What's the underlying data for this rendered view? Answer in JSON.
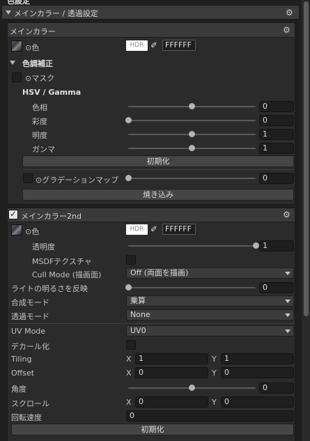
{
  "top_section_title": "色設定",
  "section_header": "メインカラー / 透過設定",
  "main_color_panel": {
    "title": "メインカラー",
    "color_label": "⊙色",
    "hdr_label": "HDR",
    "hex_value": "FFFFFF",
    "color_correction_label": "色調補正",
    "mask_label": "⊙マスク",
    "hsv_heading": "HSV / Gamma",
    "hue_label": "色相",
    "hue_value": "0",
    "saturation_label": "彩度",
    "saturation_value": "0",
    "brightness_label": "明度",
    "brightness_value": "1",
    "gamma_label": "ガンマ",
    "gamma_value": "1",
    "reset_label": "初期化",
    "gradient_map_label": "⊙グラデーションマップ",
    "gradient_map_value": "0",
    "bake_label": "焼き込み"
  },
  "main_color_2nd_panel": {
    "title": "メインカラー2nd",
    "enabled": true,
    "color_label": "⊙色",
    "hdr_label": "HDR",
    "hex_value": "FFFFFF",
    "opacity_label": "透明度",
    "opacity_value": "1",
    "msdf_label": "MSDFテクスチャ",
    "cull_mode_label": "Cull Mode (描画面)",
    "cull_mode_value": "Off (両面を描画)",
    "light_brightness_label": "ライトの明るさを反映",
    "light_brightness_value": "0",
    "blend_mode_label": "合成モード",
    "blend_mode_value": "乗算",
    "transparency_mode_label": "透過モード",
    "transparency_mode_value": "None",
    "uv_mode_label": "UV Mode",
    "uv_mode_value": "UV0",
    "decal_label": "デカール化",
    "tiling_label": "Tiling",
    "tiling_x": "1",
    "tiling_y": "1",
    "offset_label": "Offset",
    "offset_x": "0",
    "offset_y": "0",
    "angle_label": "角度",
    "angle_value": "0",
    "scroll_label": "スクロール",
    "scroll_x": "0",
    "scroll_y": "0",
    "rotation_speed_label": "回転速度",
    "rotation_speed_value": "0",
    "reset_label": "初期化",
    "x_label": "X",
    "y_label": "Y"
  },
  "sliders": {
    "hue": 0.5,
    "saturation": 0.0,
    "brightness": 0.5,
    "gamma": 0.5,
    "gradient_map": 0.0,
    "opacity": 1.0,
    "light_brightness": 0.0,
    "angle": 0.5
  },
  "icons": [
    "gear-icon",
    "eyedropper-icon",
    "chevron-down-icon",
    "foldout-triangle-icon",
    "texture-thumbnail"
  ],
  "colors": {
    "background": "#1f1f1f",
    "panel": "#2b2b2b",
    "header": "#3a3a3a",
    "knob": "#b4b4b4"
  }
}
